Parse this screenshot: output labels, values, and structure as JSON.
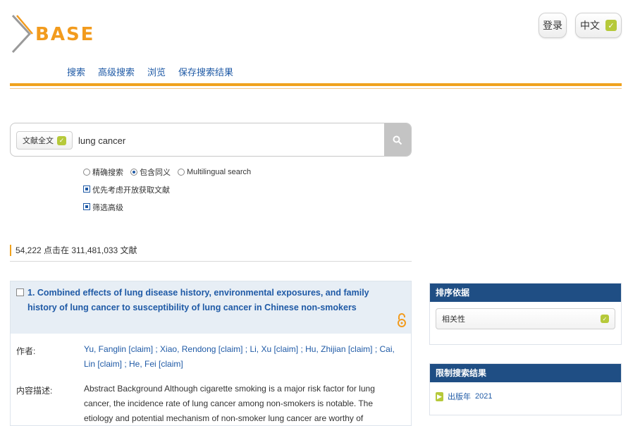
{
  "logo": {
    "text": "BASE"
  },
  "header": {
    "login_label": "登录",
    "language_label": "中文"
  },
  "nav": {
    "items": [
      "搜索",
      "高级搜索",
      "浏览",
      "保存搜索结果"
    ]
  },
  "search": {
    "scope_label": "文献全文",
    "query": "lung cancer",
    "button_icon": "search-icon"
  },
  "options": {
    "radio": [
      {
        "label": "精确搜索",
        "selected": false
      },
      {
        "label": "包含同义",
        "selected": true
      },
      {
        "label": "Multilingual search",
        "selected": false
      }
    ],
    "checkboxes": [
      {
        "label": "优先考虑开放获取文献",
        "checked": true
      },
      {
        "label": "筛选高级",
        "checked": true
      }
    ]
  },
  "results": {
    "summary": "54,222 点击在 311,481,033 文献",
    "items": [
      {
        "title": "1. Combined effects of lung disease history, environmental exposures, and family history of lung cancer to susceptibility of lung cancer in Chinese non-smokers",
        "open_access_icon": "open-access-icon",
        "author_label": "作者:",
        "authors": "Yu, Fanglin [claim] ; Xiao, Rendong [claim] ; Li, Xu [claim] ; Hu, Zhijian [claim] ; Cai, Lin [claim] ; He, Fei [claim]",
        "desc_label": "内容描述:",
        "description": "Abstract Background Although cigarette smoking is a major risk factor for lung cancer, the incidence rate of lung cancer among non-smokers is notable. The etiology and potential mechanism of non-smoker lung cancer are worthy of"
      }
    ]
  },
  "sidebar": {
    "sort": {
      "heading": "排序依据",
      "selected": "相关性"
    },
    "filter": {
      "heading": "限制搜索结果",
      "items": [
        {
          "label": "出版年",
          "value": "2021"
        }
      ]
    }
  },
  "colors": {
    "accent": "#f0a21e",
    "link": "#1f5aa6",
    "sidebar_header": "#1f4e84",
    "check_green": "#b6c93a"
  }
}
